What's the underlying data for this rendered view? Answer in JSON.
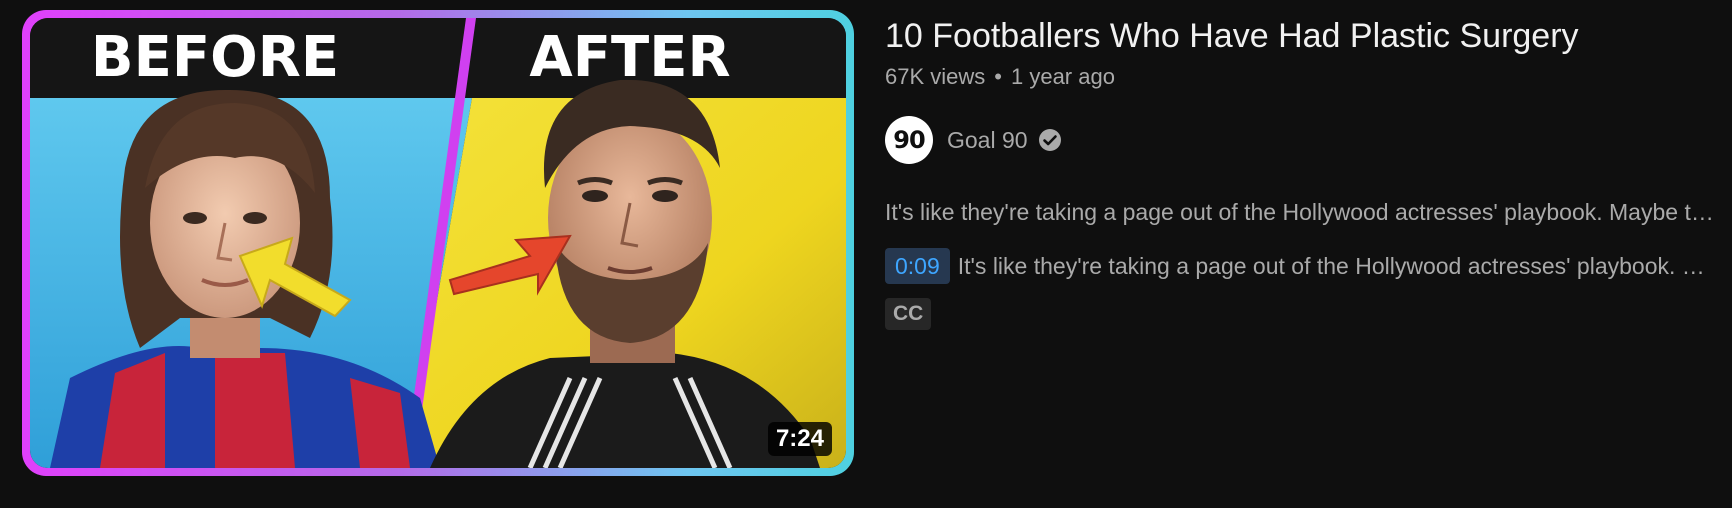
{
  "video": {
    "thumbnail": {
      "left_banner": "BEFORE",
      "right_banner": "AFTER",
      "duration": "7:24",
      "border_gradient": [
        "#e040fb",
        "#4ed0e0"
      ]
    },
    "title": "10 Footballers Who Have Had Plastic Surgery",
    "views": "67K views",
    "separator": "•",
    "age": "1 year ago",
    "channel": {
      "avatar_text": "90",
      "name": "Goal 90",
      "verified_icon": "check-circle-icon"
    },
    "description_snippet": "It's like they're taking a page out of the Hollywood actresses' playbook. Maybe they're trying to look better for the cameras",
    "chapter": {
      "timestamp": "0:09",
      "text": "It's like they're taking a page out of the Hollywood actresses' playbook. Maybe"
    },
    "badge": "CC"
  },
  "colors": {
    "background": "#0f0f0f",
    "text_primary": "#f1f1f1",
    "text_secondary": "#aaaaaa",
    "timestamp_bg": "#263850",
    "timestamp_fg": "#3ea6ff"
  }
}
